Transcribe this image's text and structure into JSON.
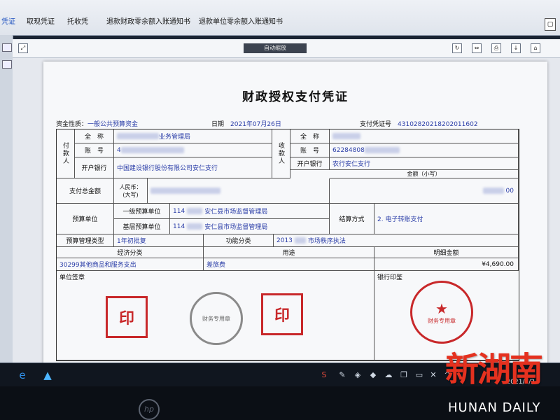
{
  "tabs": [
    {
      "label": "凭证",
      "active": true
    },
    {
      "label": "取现凭证",
      "active": false
    },
    {
      "label": "托收凭",
      "active": false
    },
    {
      "label": "退款财政零余额入账通知书",
      "active": false
    },
    {
      "label": "退款单位零余额入账通知书",
      "active": false
    }
  ],
  "viewer": {
    "title": "自动缩放"
  },
  "document": {
    "title": "财政授权支付凭证",
    "fund_nature_label": "资金性质：",
    "fund_nature_value": "一般公共预算资金",
    "date_label": "日期",
    "date_value": "2021年07月26日",
    "voucher_no_label": "支付凭证号",
    "voucher_no_value": "43102820218202011602",
    "payer": {
      "group_label": "付款人",
      "name_label": "全　称",
      "name_value": "业务管理局",
      "account_label": "账　号",
      "account_value": "4",
      "bank_label": "开户银行",
      "bank_value": "中国建设银行股份有限公司安仁支行"
    },
    "payee": {
      "group_label": "收款人",
      "name_label": "全　称",
      "account_label": "账　号",
      "account_value": "62284808",
      "bank_label": "开户银行",
      "bank_value": "农行安仁支行"
    },
    "amount_small_label": "金额（小写）",
    "amount_small_value": "00",
    "total_label": "支付总金额",
    "rmb_label": "人民币：",
    "rmb_sub_label": "(大写)",
    "budget_unit_label": "预算单位",
    "level1_label": "一级预算单位",
    "level1_value_prefix": "114",
    "level1_value": "安仁县市场监督管理局",
    "base_label": "基层预算单位",
    "base_value_prefix": "114",
    "base_value": "安仁县市场监督管理局",
    "settle_label": "结算方式",
    "settle_value": "2. 电子转账支付",
    "budget_type_label": "预算管理类型",
    "budget_type_value": "1年初批复",
    "func_label": "功能分类",
    "func_value_prefix": "2013",
    "func_value": "市场秩序执法",
    "econ_label": "经济分类",
    "purpose_label": "用途",
    "detail_label": "明细金额",
    "econ_value": "30299其他商品和服务支出",
    "purpose_value": "差旅费",
    "detail_value": "¥4,690.00",
    "unit_seal_label": "单位签章",
    "bank_seal_label": "银行印鉴",
    "stamp_yin": "印",
    "stamp_finance": "财务专用章"
  },
  "taskbar": {
    "clock": "2021/7/2"
  },
  "monitor_brand": "hp",
  "watermark": {
    "zh": "新湖南",
    "en": "HUNAN DAILY"
  },
  "colors": {
    "accent": "#2b3ea8",
    "stamp": "#c8282a",
    "watermark": "#e5311f"
  }
}
